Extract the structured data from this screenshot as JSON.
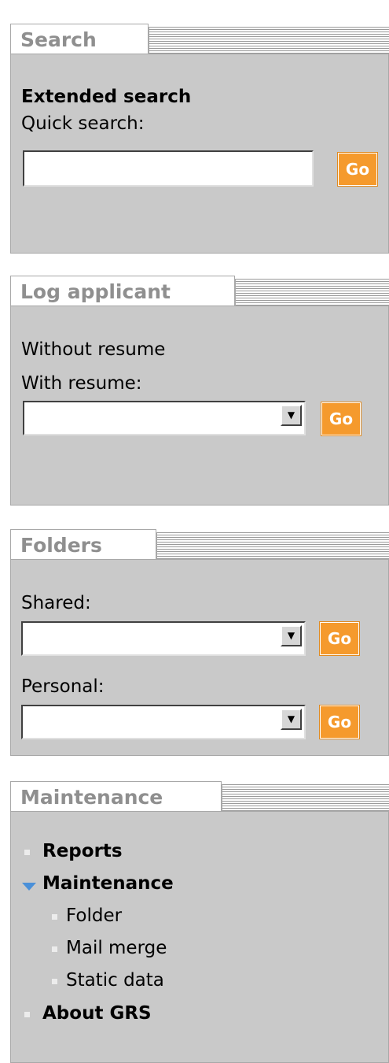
{
  "search": {
    "title": "Search",
    "extended_link": "Extended search",
    "quick_label": "Quick search:",
    "quick_value": "",
    "go_label": "Go"
  },
  "log_applicant": {
    "title": "Log applicant",
    "without_resume": "Without resume",
    "with_resume_label": "With resume:",
    "with_resume_value": "",
    "go_label": "Go"
  },
  "folders": {
    "title": "Folders",
    "shared_label": "Shared:",
    "shared_value": "",
    "shared_go": "Go",
    "personal_label": "Personal:",
    "personal_value": "",
    "personal_go": "Go"
  },
  "maintenance": {
    "title": "Maintenance",
    "items": [
      {
        "label": "Reports"
      },
      {
        "label": "Maintenance"
      },
      {
        "label": "Folder"
      },
      {
        "label": "Mail merge"
      },
      {
        "label": "Static data"
      },
      {
        "label": "About GRS"
      }
    ]
  },
  "colors": {
    "panel_bg": "#c9c9c9",
    "go_button": "#f59a2d",
    "tab_text": "#8f8f8f",
    "tree_arrow": "#4a90d9"
  },
  "icons": {
    "dropdown": "dropdown-arrow-icon",
    "bullet": "bullet-icon",
    "expanded": "expanded-triangle-icon"
  }
}
